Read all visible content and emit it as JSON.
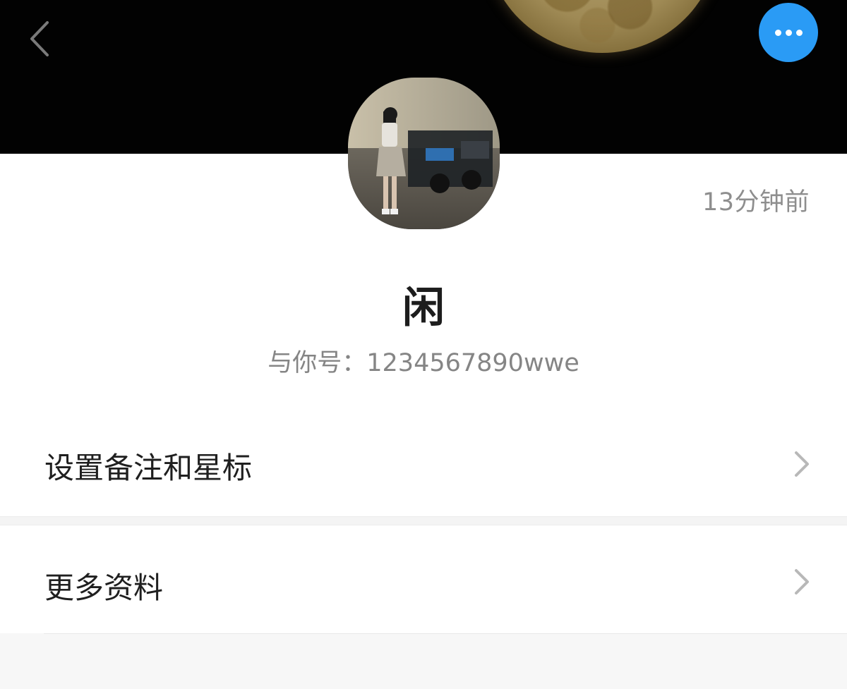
{
  "header": {
    "back_icon": "chevron-left-icon",
    "more_icon": "ellipsis-icon",
    "more_button_color": "#2a9bf5"
  },
  "profile": {
    "last_seen": "13分钟前",
    "nickname": "闲",
    "account_id": "与你号：1234567890wwe"
  },
  "menu": {
    "items": [
      {
        "label": "设置备注和星标"
      },
      {
        "label": "更多资料"
      }
    ]
  }
}
